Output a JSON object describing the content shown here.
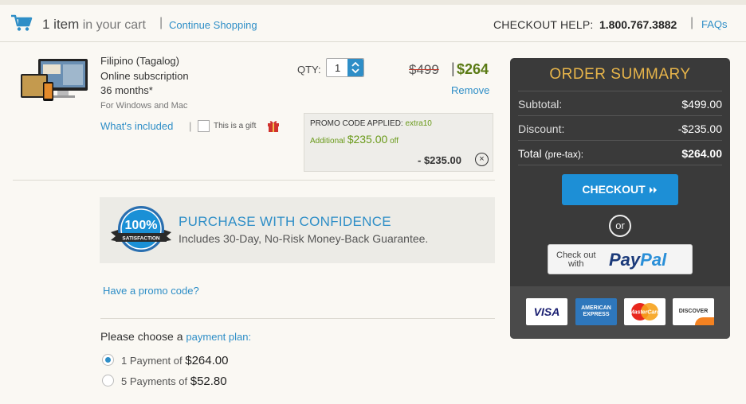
{
  "header": {
    "cart_count": "1 item",
    "cart_suffix": "in your cart",
    "continue_label": "Continue Shopping",
    "help_label": "CHECKOUT HELP:",
    "help_phone": "1.800.767.3882",
    "faqs_label": "FAQs"
  },
  "product": {
    "name": "Filipino (Tagalog)",
    "type": "Online subscription",
    "term": "36 months*",
    "platform": "For Windows and Mac",
    "whats_included": "What's included",
    "gift_label": "This is a gift",
    "qty_label": "QTY:",
    "qty_value": "1",
    "old_price": "$499",
    "new_price": "$264",
    "remove_label": "Remove"
  },
  "promo": {
    "applied_label": "PROMO CODE APPLIED:",
    "code": "extra10",
    "additional_prefix": "Additional",
    "additional_amount": "$235.00",
    "additional_suffix": "off",
    "discount": "- $235.00",
    "close_symbol": "×"
  },
  "confidence": {
    "badge_percent": "100%",
    "badge_text": "SATISFACTION",
    "title": "PURCHASE WITH CONFIDENCE",
    "subtitle": "Includes 30-Day, No-Risk Money-Back Guarantee."
  },
  "promo_link": "Have a promo code?",
  "payment_plan": {
    "prefix": "Please choose a",
    "highlight": "payment plan:",
    "options": [
      {
        "label": "1 Payment of",
        "amount": "$264.00",
        "selected": true
      },
      {
        "label": "5 Payments of",
        "amount": "$52.80",
        "selected": false
      }
    ]
  },
  "summary": {
    "title": "ORDER SUMMARY",
    "rows": [
      {
        "label": "Subtotal:",
        "value": "$499.00"
      },
      {
        "label": "Discount:",
        "value": "-$235.00"
      },
      {
        "label": "Total",
        "label_suffix": "(pre-tax):",
        "value": "$264.00"
      }
    ],
    "checkout_label": "CHECKOUT",
    "or_label": "or",
    "paypal_small_1": "Check out",
    "paypal_small_2": "with",
    "paypal_pay": "Pay",
    "paypal_pal": "Pal",
    "cards": [
      "VISA",
      "AMERICAN EXPRESS",
      "MasterCard",
      "DISCOVER"
    ]
  },
  "colors": {
    "accent_blue": "#2e8ec7",
    "price_green": "#5a7a14",
    "summary_bg": "#3a3a3a",
    "summary_title": "#e8b54a",
    "checkout_blue": "#1d8fd6"
  }
}
